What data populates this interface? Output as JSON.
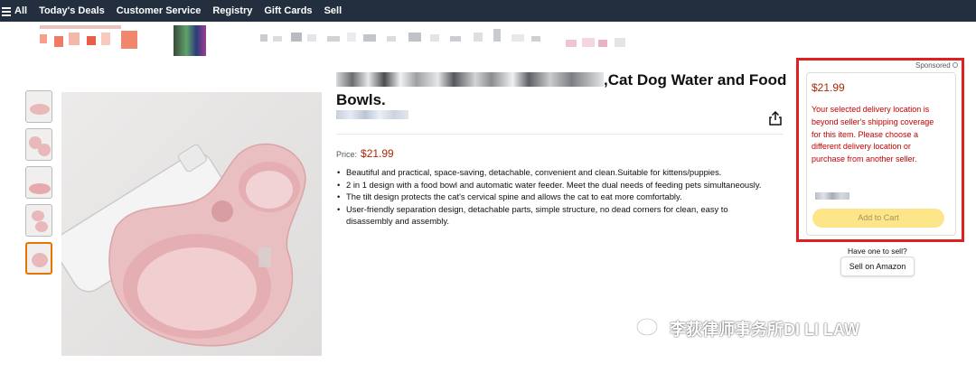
{
  "nav": {
    "all_label": "All",
    "items": [
      "Today's Deals",
      "Customer Service",
      "Registry",
      "Gift Cards",
      "Sell"
    ]
  },
  "product": {
    "title_visible": ",Cat Dog Water and Food",
    "title_line2": "Bowls.",
    "price_label": "Price:",
    "price": "$21.99",
    "bullets": [
      "Beautiful and practical, space-saving, detachable, convenient and clean.Suitable for kittens/puppies.",
      "2 in 1 design with a food bowl and automatic water feeder. Meet the dual needs of feeding pets simultaneously.",
      "The tilt design protects the cat's cervical spine and allows the cat to eat more comfortably.",
      "User-friendly separation design, detachable parts, simple structure, no dead corners for clean, easy to disassembly and assembly."
    ]
  },
  "buybox": {
    "sponsored": "Sponsored",
    "price": "$21.99",
    "message": "Your selected delivery location is beyond seller's shipping coverage for this item. Please choose a different delivery location or purchase from another seller.",
    "add_to_cart": "Add to Cart"
  },
  "sell": {
    "have_one": "Have one to sell?",
    "button": "Sell on Amazon"
  },
  "watermark": "李荻律师事务所DI LI LAW",
  "colors": {
    "nav_bg": "#232f3e",
    "price": "#b12704",
    "alert_text": "#c40000",
    "highlight_frame": "#e02020",
    "add_to_cart_bg": "#fde68a",
    "thumb_active": "#e77600"
  }
}
